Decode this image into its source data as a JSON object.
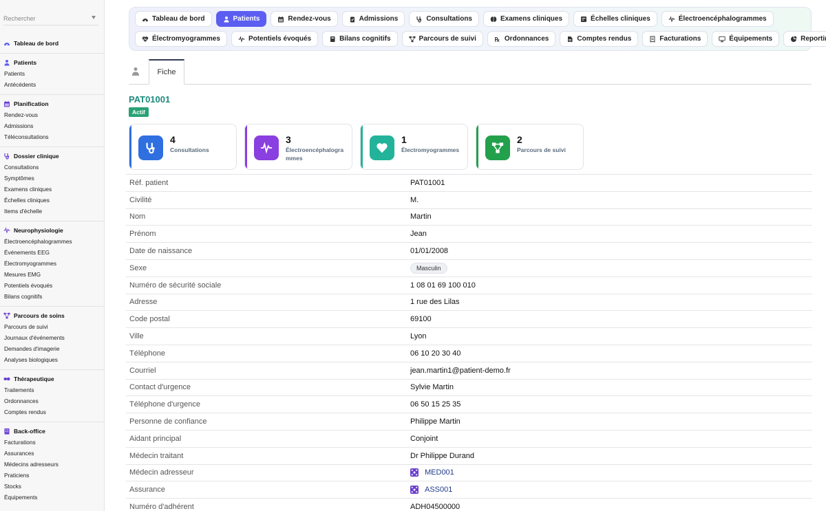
{
  "sidebar": {
    "search_placeholder": "Rechercher",
    "sections": [
      {
        "id": "dashboard",
        "title": "Tableau de bord",
        "icon": "dashboard-icon",
        "color": "#5b5ef0",
        "items": []
      },
      {
        "id": "patients",
        "title": "Patients",
        "icon": "user-icon",
        "color": "#5b5ef0",
        "items": [
          "Patients",
          "Antécédents"
        ]
      },
      {
        "id": "planning",
        "title": "Planification",
        "icon": "calendar-icon",
        "color": "#6a3fd0",
        "items": [
          "Rendez-vous",
          "Admissions",
          "Téléconsultations"
        ]
      },
      {
        "id": "clinical",
        "title": "Dossier clinique",
        "icon": "stethoscope-icon",
        "color": "#6a3fd0",
        "items": [
          "Consultations",
          "Symptômes",
          "Examens cliniques",
          "Échelles cliniques",
          "Items d'échelle"
        ]
      },
      {
        "id": "neuro",
        "title": "Neurophysiologie",
        "icon": "waveform-icon",
        "color": "#6a3fd0",
        "items": [
          "Électroencéphalogrammes",
          "Événements EEG",
          "Électromyogrammes",
          "Mesures EMG",
          "Potentiels évoqués",
          "Bilans cognitifs"
        ]
      },
      {
        "id": "care",
        "title": "Parcours de soins",
        "icon": "flow-icon",
        "color": "#6a3fd0",
        "items": [
          "Parcours de suivi",
          "Journaux d'événements",
          "Demandes d'imagerie",
          "Analyses biologiques"
        ]
      },
      {
        "id": "therapy",
        "title": "Thérapeutique",
        "icon": "pills-icon",
        "color": "#6a3fd0",
        "items": [
          "Traitements",
          "Ordonnances",
          "Comptes rendus"
        ]
      },
      {
        "id": "backoffice",
        "title": "Back-office",
        "icon": "building-icon",
        "color": "#6a3fd0",
        "items": [
          "Facturations",
          "Assurances",
          "Médecins adresseurs",
          "Praticiens",
          "Stocks",
          "Équipements"
        ]
      }
    ]
  },
  "topnav": {
    "row1": [
      {
        "label": "Tableau de bord",
        "icon": "dashboard-icon",
        "active": false
      },
      {
        "label": "Patients",
        "icon": "user-icon",
        "active": true
      },
      {
        "label": "Rendez-vous",
        "icon": "calendar-icon",
        "active": false
      },
      {
        "label": "Admissions",
        "icon": "clipboard-icon",
        "active": false
      },
      {
        "label": "Consultations",
        "icon": "stethoscope-icon",
        "active": false
      },
      {
        "label": "Examens cliniques",
        "icon": "brain-icon",
        "active": false
      },
      {
        "label": "Échelles cliniques",
        "icon": "scale-icon",
        "active": false
      },
      {
        "label": "Électroencéphalogrammes",
        "icon": "waveform-icon",
        "active": false
      }
    ],
    "row2": [
      {
        "label": "Électromyogrammes",
        "icon": "heart-pulse-icon",
        "active": false
      },
      {
        "label": "Potentiels évoqués",
        "icon": "waveform-icon",
        "active": false
      },
      {
        "label": "Bilans cognitifs",
        "icon": "book-icon",
        "active": false
      },
      {
        "label": "Parcours de suivi",
        "icon": "flow-icon",
        "active": false
      },
      {
        "label": "Ordonnances",
        "icon": "prescription-icon",
        "active": false
      },
      {
        "label": "Comptes rendus",
        "icon": "report-icon",
        "active": false
      },
      {
        "label": "Facturations",
        "icon": "invoice-icon",
        "active": false
      },
      {
        "label": "Équipements",
        "icon": "monitor-icon",
        "active": false
      },
      {
        "label": "Reporting",
        "icon": "pie-chart-icon",
        "active": false
      }
    ]
  },
  "tabs": {
    "fiche_label": "Fiche"
  },
  "patient": {
    "id": "PAT01001",
    "status": "Actif"
  },
  "cards": [
    {
      "value": "4",
      "label": "Consultations",
      "color": "#2f6fe0",
      "icon": "stethoscope-icon"
    },
    {
      "value": "3",
      "label": "Électroencéphalogrammes",
      "color": "#8a3fe0",
      "icon": "waveform-icon"
    },
    {
      "value": "1",
      "label": "Électromyogrammes",
      "color": "#22b39a",
      "icon": "heart-pulse-icon"
    },
    {
      "value": "2",
      "label": "Parcours de suivi",
      "color": "#23a04c",
      "icon": "flow-icon"
    }
  ],
  "details": [
    {
      "label": "Réf. patient",
      "value": "PAT01001",
      "kind": "text"
    },
    {
      "label": "Civilité",
      "value": "M.",
      "kind": "text"
    },
    {
      "label": "Nom",
      "value": "Martin",
      "kind": "text"
    },
    {
      "label": "Prénom",
      "value": "Jean",
      "kind": "text"
    },
    {
      "label": "Date de naissance",
      "value": "01/01/2008",
      "kind": "text"
    },
    {
      "label": "Sexe",
      "value": "Masculin",
      "kind": "chip"
    },
    {
      "label": "Numéro de sécurité sociale",
      "value": "1 08 01 69 100 010",
      "kind": "text"
    },
    {
      "label": "Adresse",
      "value": "1 rue des Lilas",
      "kind": "text"
    },
    {
      "label": "Code postal",
      "value": "69100",
      "kind": "text"
    },
    {
      "label": "Ville",
      "value": "Lyon",
      "kind": "text"
    },
    {
      "label": "Téléphone",
      "value": "06 10 20 30 40",
      "kind": "text"
    },
    {
      "label": "Courriel",
      "value": "jean.martin1@patient-demo.fr",
      "kind": "text"
    },
    {
      "label": "Contact d'urgence",
      "value": "Sylvie Martin",
      "kind": "text"
    },
    {
      "label": "Téléphone d'urgence",
      "value": "06 50 15 25 35",
      "kind": "text"
    },
    {
      "label": "Personne de confiance",
      "value": "Philippe Martin",
      "kind": "text"
    },
    {
      "label": "Aidant principal",
      "value": "Conjoint",
      "kind": "text"
    },
    {
      "label": "Médecin traitant",
      "value": "Dr Philippe Durand",
      "kind": "text"
    },
    {
      "label": "Médecin adresseur",
      "value": "MED001",
      "kind": "ref"
    },
    {
      "label": "Assurance",
      "value": "ASS001",
      "kind": "ref"
    },
    {
      "label": "Numéro d'adhérent",
      "value": "ADH04500000",
      "kind": "text"
    }
  ]
}
